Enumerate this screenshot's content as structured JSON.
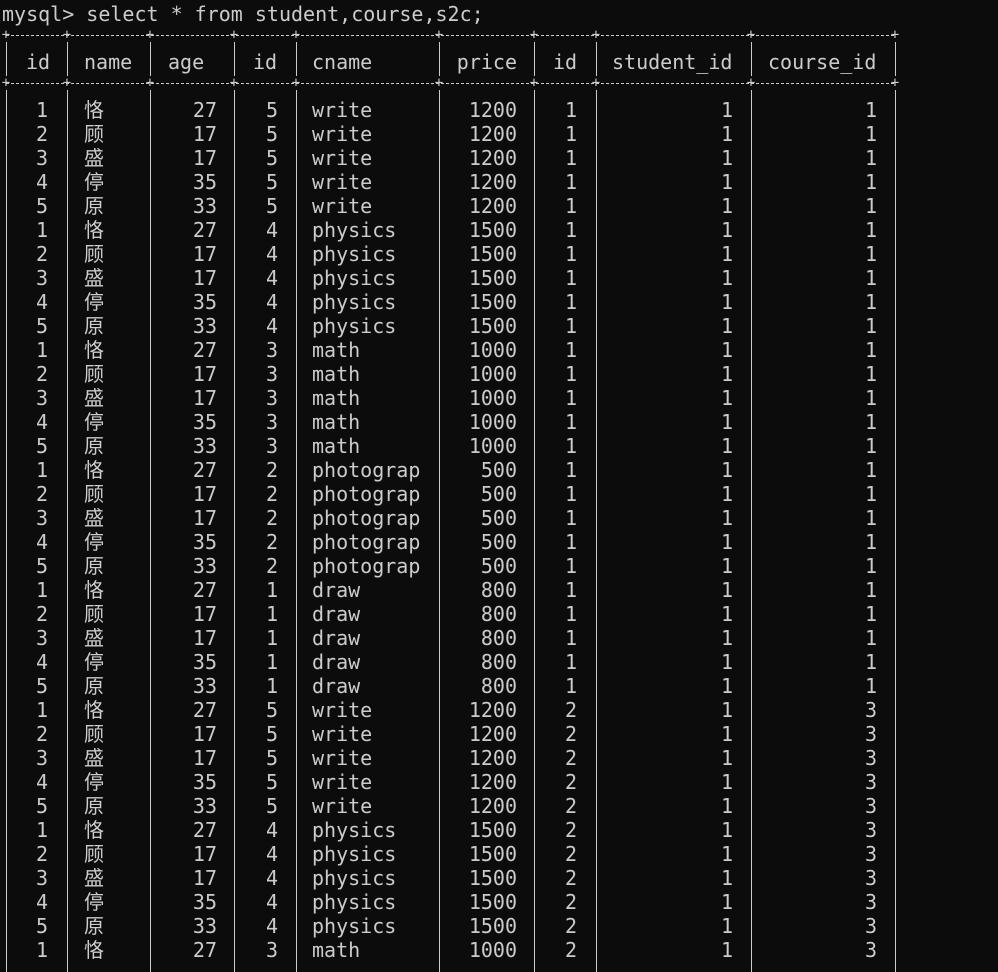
{
  "prompt": "mysql>",
  "command": "select * from student,course,s2c;",
  "columns": [
    "id",
    "name",
    "age",
    "id",
    "cname",
    "price",
    "id",
    "student_id",
    "course_id"
  ],
  "rows": [
    [
      "1",
      "恪",
      "27",
      "5",
      "write",
      "1200",
      "1",
      "1",
      "1"
    ],
    [
      "2",
      "顾",
      "17",
      "5",
      "write",
      "1200",
      "1",
      "1",
      "1"
    ],
    [
      "3",
      "盛",
      "17",
      "5",
      "write",
      "1200",
      "1",
      "1",
      "1"
    ],
    [
      "4",
      "停",
      "35",
      "5",
      "write",
      "1200",
      "1",
      "1",
      "1"
    ],
    [
      "5",
      "原",
      "33",
      "5",
      "write",
      "1200",
      "1",
      "1",
      "1"
    ],
    [
      "1",
      "恪",
      "27",
      "4",
      "physics",
      "1500",
      "1",
      "1",
      "1"
    ],
    [
      "2",
      "顾",
      "17",
      "4",
      "physics",
      "1500",
      "1",
      "1",
      "1"
    ],
    [
      "3",
      "盛",
      "17",
      "4",
      "physics",
      "1500",
      "1",
      "1",
      "1"
    ],
    [
      "4",
      "停",
      "35",
      "4",
      "physics",
      "1500",
      "1",
      "1",
      "1"
    ],
    [
      "5",
      "原",
      "33",
      "4",
      "physics",
      "1500",
      "1",
      "1",
      "1"
    ],
    [
      "1",
      "恪",
      "27",
      "3",
      "math",
      "1000",
      "1",
      "1",
      "1"
    ],
    [
      "2",
      "顾",
      "17",
      "3",
      "math",
      "1000",
      "1",
      "1",
      "1"
    ],
    [
      "3",
      "盛",
      "17",
      "3",
      "math",
      "1000",
      "1",
      "1",
      "1"
    ],
    [
      "4",
      "停",
      "35",
      "3",
      "math",
      "1000",
      "1",
      "1",
      "1"
    ],
    [
      "5",
      "原",
      "33",
      "3",
      "math",
      "1000",
      "1",
      "1",
      "1"
    ],
    [
      "1",
      "恪",
      "27",
      "2",
      "photograp",
      "500",
      "1",
      "1",
      "1"
    ],
    [
      "2",
      "顾",
      "17",
      "2",
      "photograp",
      "500",
      "1",
      "1",
      "1"
    ],
    [
      "3",
      "盛",
      "17",
      "2",
      "photograp",
      "500",
      "1",
      "1",
      "1"
    ],
    [
      "4",
      "停",
      "35",
      "2",
      "photograp",
      "500",
      "1",
      "1",
      "1"
    ],
    [
      "5",
      "原",
      "33",
      "2",
      "photograp",
      "500",
      "1",
      "1",
      "1"
    ],
    [
      "1",
      "恪",
      "27",
      "1",
      "draw",
      "800",
      "1",
      "1",
      "1"
    ],
    [
      "2",
      "顾",
      "17",
      "1",
      "draw",
      "800",
      "1",
      "1",
      "1"
    ],
    [
      "3",
      "盛",
      "17",
      "1",
      "draw",
      "800",
      "1",
      "1",
      "1"
    ],
    [
      "4",
      "停",
      "35",
      "1",
      "draw",
      "800",
      "1",
      "1",
      "1"
    ],
    [
      "5",
      "原",
      "33",
      "1",
      "draw",
      "800",
      "1",
      "1",
      "1"
    ],
    [
      "1",
      "恪",
      "27",
      "5",
      "write",
      "1200",
      "2",
      "1",
      "3"
    ],
    [
      "2",
      "顾",
      "17",
      "5",
      "write",
      "1200",
      "2",
      "1",
      "3"
    ],
    [
      "3",
      "盛",
      "17",
      "5",
      "write",
      "1200",
      "2",
      "1",
      "3"
    ],
    [
      "4",
      "停",
      "35",
      "5",
      "write",
      "1200",
      "2",
      "1",
      "3"
    ],
    [
      "5",
      "原",
      "33",
      "5",
      "write",
      "1200",
      "2",
      "1",
      "3"
    ],
    [
      "1",
      "恪",
      "27",
      "4",
      "physics",
      "1500",
      "2",
      "1",
      "3"
    ],
    [
      "2",
      "顾",
      "17",
      "4",
      "physics",
      "1500",
      "2",
      "1",
      "3"
    ],
    [
      "3",
      "盛",
      "17",
      "4",
      "physics",
      "1500",
      "2",
      "1",
      "3"
    ],
    [
      "4",
      "停",
      "35",
      "4",
      "physics",
      "1500",
      "2",
      "1",
      "3"
    ],
    [
      "5",
      "原",
      "33",
      "4",
      "physics",
      "1500",
      "2",
      "1",
      "3"
    ],
    [
      "1",
      "恪",
      "27",
      "3",
      "math",
      "1000",
      "2",
      "1",
      "3"
    ]
  ],
  "colors": {
    "background": "#0c0c0c",
    "text": "#cccccc"
  }
}
